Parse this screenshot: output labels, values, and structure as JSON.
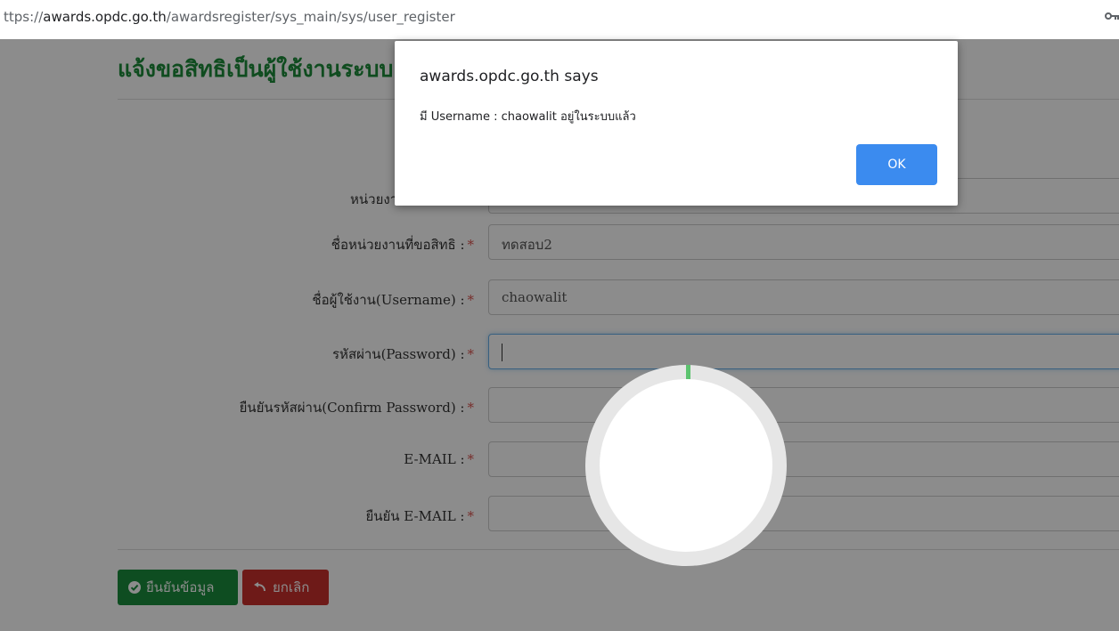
{
  "browser": {
    "url_prefix": "ttps://",
    "url_host": "awards.opdc.go.th",
    "url_path": "/awardsregister/sys_main/sys/user_register"
  },
  "page": {
    "title": "แจ้งขอสิทธิเป็นผู้ใช้งานระบบ",
    "required_mark": "*",
    "fields": [
      {
        "label": "หน่วยงานต้นสังกัด :",
        "value": ""
      },
      {
        "label": "ชื่อหน่วยงานที่ขอสิทธิ :",
        "value": "ทดสอบ2"
      },
      {
        "label": "ชื่อผู้ใช้งาน(Username) :",
        "value": "chaowalit"
      },
      {
        "label": "รหัสผ่าน(Password) :",
        "value": ""
      },
      {
        "label": "ยืนยันรหัสผ่าน(Confirm Password) :",
        "value": ""
      },
      {
        "label": "E-MAIL :",
        "value": ""
      },
      {
        "label": "ยืนยัน E-MAIL :",
        "value": ""
      }
    ],
    "buttons": {
      "confirm": "ยืนยันข้อมูล",
      "cancel": "ยกเลิก"
    }
  },
  "dialog": {
    "title": "awards.opdc.go.th says",
    "message": "มี Username :  chaowalit อยู่ในระบบแล้ว",
    "ok": "OK"
  },
  "colors": {
    "heading": "#1c8a3a",
    "confirm_button": "#1a8d3c",
    "cancel_button": "#c9302c",
    "dialog_ok": "#3b8bef",
    "spinner_progress": "#5cc36f"
  },
  "icons": {
    "confirm": "check-circle-icon",
    "cancel": "undo-icon",
    "address_bar": "key-icon"
  }
}
